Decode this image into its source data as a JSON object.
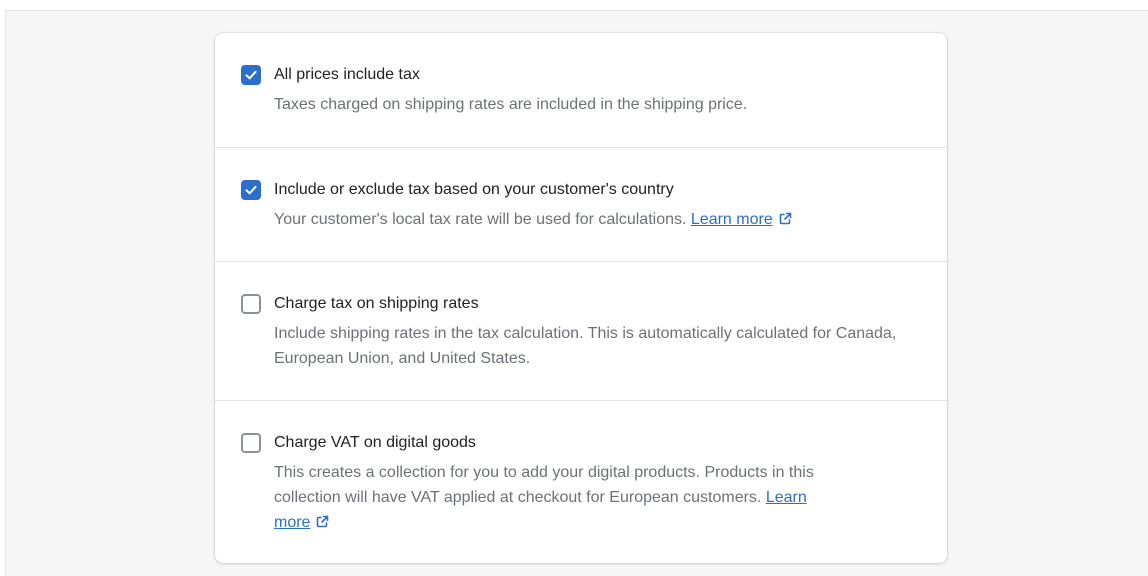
{
  "options": [
    {
      "label": "All prices include tax",
      "help": "Taxes charged on shipping rates are included in the shipping price.",
      "checked": true
    },
    {
      "label": "Include or exclude tax based on your customer's country",
      "help": "Your customer's local tax rate will be used for calculations.",
      "link": "Learn more",
      "checked": true
    },
    {
      "label": "Charge tax on shipping rates",
      "help": "Include shipping rates in the tax calculation. This is automatically calculated for Canada, European Union, and United States.",
      "checked": false
    },
    {
      "label": "Charge VAT on digital goods",
      "help_line1": "This creates a collection for you to add your digital products. Products in this",
      "help_line2": "collection will have VAT applied at checkout for European customers.",
      "link_part1": "Learn",
      "link_part2": "more",
      "checked": false
    }
  ],
  "colors": {
    "accent": "#2c6ecb",
    "text": "#202223",
    "subdued": "#6d7175",
    "background": "#f6f6f7",
    "divider": "#e1e3e5"
  }
}
